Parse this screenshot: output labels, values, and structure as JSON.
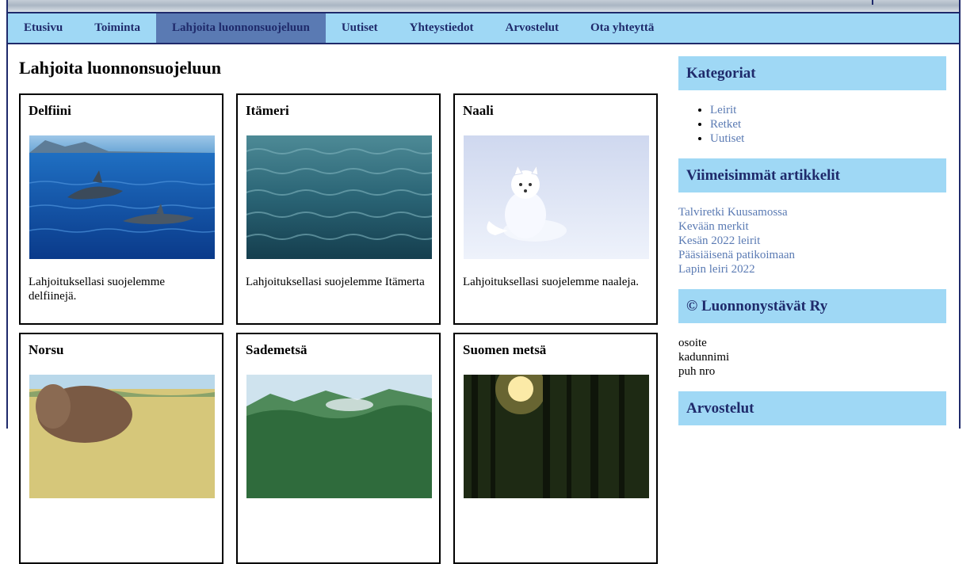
{
  "nav": {
    "items": [
      {
        "label": "Etusivu"
      },
      {
        "label": "Toiminta"
      },
      {
        "label": "Lahjoita luonnonsuojeluun",
        "active": true
      },
      {
        "label": "Uutiset"
      },
      {
        "label": "Yhteystiedot"
      },
      {
        "label": "Arvostelut"
      },
      {
        "label": "Ota yhteyttä"
      }
    ]
  },
  "main": {
    "title": "Lahjoita luonnonsuojeluun",
    "cards": [
      {
        "title": "Delfiini",
        "text": "Lahjoituksellasi suojelemme delfiinejä.",
        "image": "dolphin-photo"
      },
      {
        "title": "Itämeri",
        "text": "Lahjoituksellasi suojelemme Itämerta",
        "image": "sea-photo"
      },
      {
        "title": "Naali",
        "text": "Lahjoituksellasi suojelemme naaleja.",
        "image": "arctic-fox-photo"
      },
      {
        "title": "Norsu",
        "text": "",
        "image": "elephant-photo"
      },
      {
        "title": "Sademetsä",
        "text": "",
        "image": "rainforest-photo"
      },
      {
        "title": "Suomen metsä",
        "text": "",
        "image": "finnish-forest-photo"
      }
    ]
  },
  "sidebar": {
    "categories": {
      "heading": "Kategoriat",
      "items": [
        "Leirit",
        "Retket",
        "Uutiset"
      ]
    },
    "recent": {
      "heading": "Viimeisimmät artikkelit",
      "items": [
        "Talviretki Kuusamossa",
        "Kevään merkit",
        "Kesän 2022 leirit",
        "Pääsiäisenä patikoimaan",
        "Lapin leiri 2022"
      ]
    },
    "contact": {
      "heading": "© Luonnonystävät Ry",
      "lines": [
        "osoite",
        "kadunnimi",
        "puh nro"
      ]
    },
    "reviews": {
      "heading": "Arvostelut"
    }
  },
  "colors": {
    "nav_bg": "#9fd8f5",
    "nav_active": "#5a7ab3",
    "text_dark_blue": "#1f2a6b",
    "link": "#5a7ab3"
  }
}
